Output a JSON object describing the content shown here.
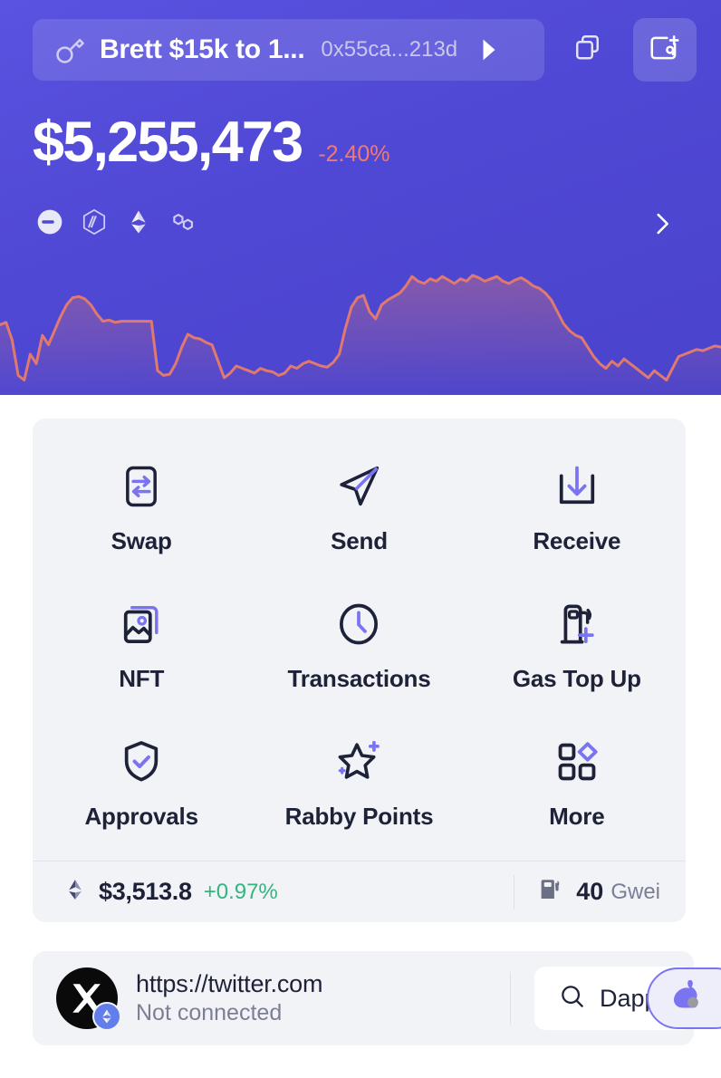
{
  "header": {
    "account": {
      "icon": "key-icon",
      "name": "Brett $15k to 1...",
      "address": "0x55ca...213d",
      "caret": "caret-right-icon"
    },
    "buttons": [
      {
        "name": "copy-address-button",
        "icon": "copy-icon"
      },
      {
        "name": "add-wallet-button",
        "icon": "add-wallet-icon"
      }
    ],
    "balance": {
      "total": "$5,255,473",
      "change": "-2.40%",
      "change_color": "#f07a6e"
    },
    "chains": [
      {
        "name": "chain-base",
        "icon": "base-chain-icon"
      },
      {
        "name": "chain-arbitrum",
        "icon": "arbitrum-chain-icon"
      },
      {
        "name": "chain-ethereum",
        "icon": "ethereum-chain-icon"
      },
      {
        "name": "chain-polygon",
        "icon": "polygon-chain-icon"
      }
    ],
    "chains_more": "chevron-right-icon",
    "accent_bg": "#4f48d4"
  },
  "chart_data": {
    "type": "area",
    "title": "",
    "xlabel": "",
    "ylabel": "",
    "grid": false,
    "legend": false,
    "line_color": "#e0796f",
    "fill_color": "rgba(224,121,111,0.22)",
    "x": [
      0,
      1,
      2,
      3,
      4,
      5,
      6,
      7,
      8,
      9,
      10,
      11,
      12,
      13,
      14,
      15,
      16,
      17,
      18,
      19,
      20,
      21,
      22,
      23,
      24,
      25,
      26,
      27,
      28,
      29,
      30,
      31,
      32,
      33,
      34,
      35,
      36,
      37,
      38,
      39,
      40,
      41,
      42,
      43,
      44,
      45,
      46,
      47,
      48,
      49,
      50,
      51,
      52,
      53,
      54,
      55,
      56,
      57,
      58,
      59,
      60,
      61,
      62,
      63,
      64,
      65,
      66,
      67,
      68,
      69,
      70,
      71,
      72,
      73,
      74,
      75,
      76,
      77,
      78,
      79,
      80,
      81,
      82,
      83,
      84,
      85,
      86,
      87,
      88,
      89,
      90,
      91,
      92,
      93,
      94,
      95,
      96,
      97,
      98,
      99,
      100,
      101,
      102,
      103,
      104,
      105,
      106,
      107,
      108,
      109,
      110,
      111,
      112,
      113,
      114,
      115,
      116,
      117,
      118,
      119
    ],
    "values": [
      55,
      57,
      42,
      12,
      8,
      30,
      22,
      46,
      38,
      50,
      62,
      72,
      78,
      79,
      77,
      72,
      64,
      58,
      59,
      57,
      58,
      58,
      58,
      58,
      58,
      58,
      16,
      12,
      13,
      22,
      36,
      47,
      44,
      43,
      40,
      38,
      24,
      10,
      14,
      20,
      18,
      16,
      14,
      18,
      16,
      15,
      12,
      14,
      20,
      18,
      22,
      24,
      22,
      20,
      19,
      23,
      30,
      52,
      70,
      78,
      80,
      66,
      60,
      72,
      76,
      79,
      82,
      88,
      96,
      92,
      90,
      94,
      92,
      96,
      93,
      90,
      94,
      92,
      97,
      95,
      92,
      94,
      96,
      92,
      90,
      93,
      95,
      92,
      88,
      86,
      82,
      76,
      66,
      56,
      50,
      46,
      44,
      36,
      28,
      22,
      18,
      24,
      20,
      26,
      22,
      18,
      14,
      10,
      16,
      12,
      8,
      18,
      28,
      30,
      32,
      34,
      33,
      35,
      37,
      36
    ],
    "ylim": [
      0,
      100
    ]
  },
  "actions": {
    "rows": [
      [
        {
          "name": "swap-action",
          "label": "Swap",
          "icon": "swap-icon"
        },
        {
          "name": "send-action",
          "label": "Send",
          "icon": "send-icon"
        },
        {
          "name": "receive-action",
          "label": "Receive",
          "icon": "receive-icon"
        }
      ],
      [
        {
          "name": "nft-action",
          "label": "NFT",
          "icon": "nft-image-icon"
        },
        {
          "name": "transactions-action",
          "label": "Transactions",
          "icon": "clock-icon"
        },
        {
          "name": "gas-top-up-action",
          "label": "Gas Top Up",
          "icon": "gas-pump-plus-icon"
        }
      ],
      [
        {
          "name": "approvals-action",
          "label": "Approvals",
          "icon": "shield-check-icon"
        },
        {
          "name": "rabby-points-action",
          "label": "Rabby Points",
          "icon": "star-sparkle-icon"
        },
        {
          "name": "more-action",
          "label": "More",
          "icon": "grid-more-icon"
        }
      ]
    ],
    "footer": {
      "eth_icon": "ethereum-icon",
      "eth_price": "$3,513.8",
      "eth_change": "+0.97%",
      "eth_change_color": "#36b37e",
      "gas_icon": "gas-pump-icon",
      "gas_value": "40",
      "gas_unit": "Gwei"
    }
  },
  "connection": {
    "avatar_icon": "x-twitter-avatar",
    "avatar_badge_icon": "ethereum-badge-icon",
    "url": "https://twitter.com",
    "status": "Not connected",
    "dapps_button": {
      "label": "Dapps",
      "icon": "search-icon"
    },
    "rabby_icon": "rabbit-icon"
  }
}
